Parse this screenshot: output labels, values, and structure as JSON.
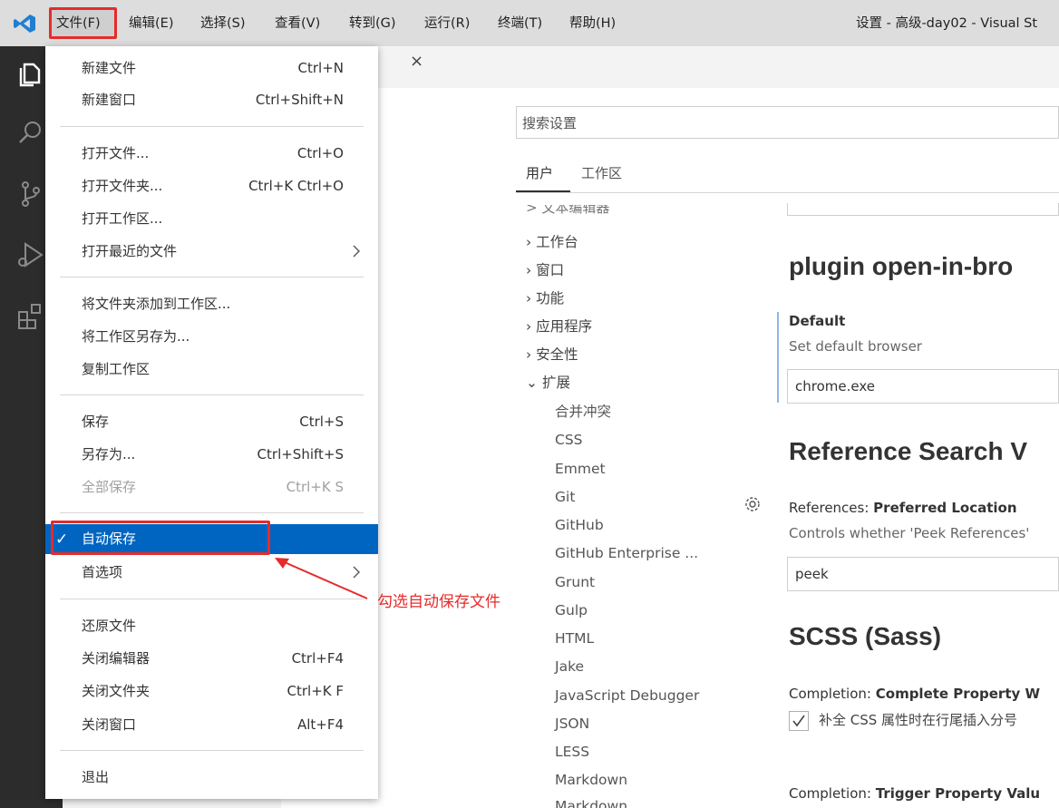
{
  "titlebar": {
    "menus": [
      "文件(F)",
      "编辑(E)",
      "选择(S)",
      "查看(V)",
      "转到(G)",
      "运行(R)",
      "终端(T)",
      "帮助(H)"
    ],
    "window_title": "设置 - 高级-day02 - Visual St"
  },
  "tab": {
    "close_glyph": "×"
  },
  "settings": {
    "search_placeholder": "搜索设置",
    "scope_user": "用户",
    "scope_workspace": "工作区",
    "toc_cut": "> 文本编辑器",
    "toc": [
      "工作台",
      "窗口",
      "功能",
      "应用程序",
      "安全性",
      "扩展"
    ],
    "toc_collapsed_glyph": "›",
    "toc_expanded_glyph": "⌄",
    "toc_sub": [
      "合并冲突",
      "CSS",
      "Emmet",
      "Git",
      "GitHub",
      "GitHub Enterprise ...",
      "Grunt",
      "Gulp",
      "HTML",
      "Jake",
      "JavaScript Debugger",
      "JSON",
      "LESS",
      "Markdown",
      "Markdown"
    ],
    "section_plugin": "plugin open-in-bro",
    "default_title": "Default",
    "default_desc": "Set default browser",
    "default_value": "chrome.exe",
    "section_reference": "Reference Search V",
    "ref_title_prefix": "References: ",
    "ref_title_bold": "Preferred Location",
    "ref_desc": "Controls whether 'Peek References'",
    "ref_value": "peek",
    "section_scss": "SCSS (Sass)",
    "scss_title_prefix": "Completion: ",
    "scss_title_bold": "Complete Property W",
    "scss_check_label": "补全 CSS 属性时在行尾插入分号",
    "scss2_title_prefix": "Completion: ",
    "scss2_title_bold": "Trigger Property Valu"
  },
  "file_menu": {
    "new_file": "新建文件",
    "new_file_sc": "Ctrl+N",
    "new_window": "新建窗口",
    "new_window_sc": "Ctrl+Shift+N",
    "open_file": "打开文件...",
    "open_file_sc": "Ctrl+O",
    "open_folder": "打开文件夹...",
    "open_folder_sc": "Ctrl+K Ctrl+O",
    "open_workspace": "打开工作区...",
    "open_recent": "打开最近的文件",
    "add_folder": "将文件夹添加到工作区...",
    "save_workspace_as": "将工作区另存为...",
    "duplicate_workspace": "复制工作区",
    "save": "保存",
    "save_sc": "Ctrl+S",
    "save_as": "另存为...",
    "save_as_sc": "Ctrl+Shift+S",
    "save_all": "全部保存",
    "save_all_sc": "Ctrl+K S",
    "auto_save": "自动保存",
    "auto_save_check": "✓",
    "preferences": "首选项",
    "revert": "还原文件",
    "close_editor": "关闭编辑器",
    "close_editor_sc": "Ctrl+F4",
    "close_folder": "关闭文件夹",
    "close_folder_sc": "Ctrl+K F",
    "close_window": "关闭窗口",
    "close_window_sc": "Alt+F4",
    "exit": "退出"
  },
  "annotation": {
    "text": "勾选自动保存文件",
    "color": "#e52b2b"
  },
  "colors": {
    "accent": "#0065c1",
    "highlight_box": "#e52b2b",
    "activity_bar": "#2c2c2c"
  }
}
